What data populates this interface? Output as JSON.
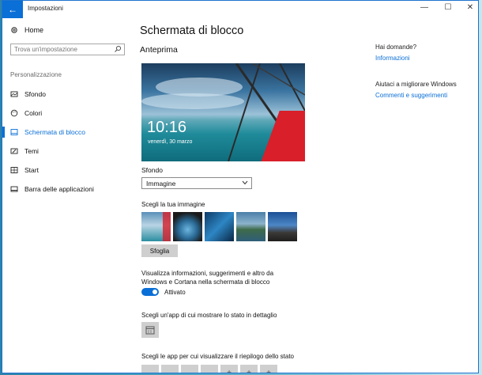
{
  "window": {
    "title": "Impostazioni",
    "back_glyph": "←",
    "controls": {
      "minimize": "—",
      "maximize": "☐",
      "close": "✕"
    }
  },
  "sidebar": {
    "home_label": "Home",
    "search_placeholder": "Trova un'impostazione",
    "section_label": "Personalizzazione",
    "items": [
      {
        "label": "Sfondo",
        "icon": "picture-icon"
      },
      {
        "label": "Colori",
        "icon": "palette-icon"
      },
      {
        "label": "Schermata di blocco",
        "icon": "lock-screen-icon",
        "active": true
      },
      {
        "label": "Temi",
        "icon": "brush-icon"
      },
      {
        "label": "Start",
        "icon": "start-icon"
      },
      {
        "label": "Barra delle applicazioni",
        "icon": "taskbar-icon"
      }
    ]
  },
  "main": {
    "title": "Schermata di blocco",
    "preview_heading": "Anteprima",
    "preview_time": "10:16",
    "preview_date": "venerdì, 30 marzo",
    "background_label": "Sfondo",
    "background_value": "Immagine",
    "choose_image_label": "Scegli la tua immagine",
    "browse_button": "Sfoglia",
    "info_text": "Visualizza informazioni, suggerimenti e altro da Windows e Cortana nella schermata di blocco",
    "toggle_state": "Attivato",
    "detail_app_label": "Scegli un'app di cui mostrare lo stato in dettaglio",
    "summary_apps_label": "Scegli le app per cui visualizzare il riepilogo dello stato",
    "summary_apps_slots": [
      "",
      "",
      "",
      "",
      "+",
      "+",
      "+"
    ]
  },
  "help": {
    "question_heading": "Hai domande?",
    "question_link": "Informazioni",
    "improve_heading": "Aiutaci a migliorare Windows",
    "improve_link": "Commenti e suggerimenti"
  },
  "colors": {
    "accent": "#0a6fd6",
    "toggle_on": "#0a6fd6"
  }
}
